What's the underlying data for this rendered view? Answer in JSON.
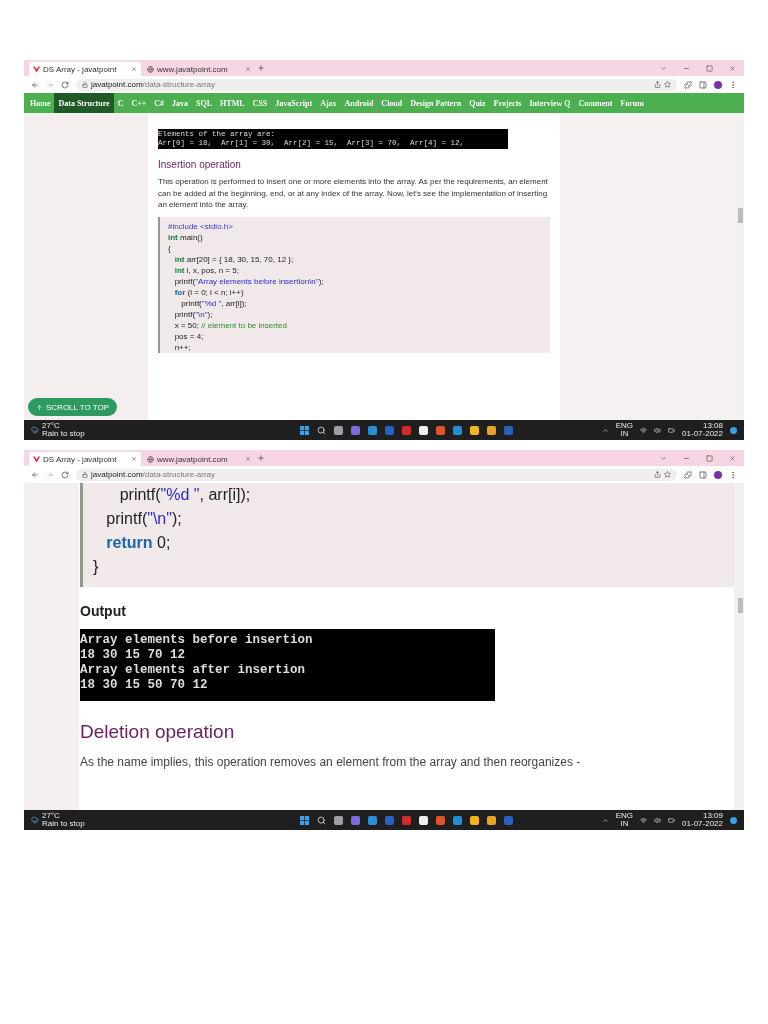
{
  "screenshots": [
    {
      "tabs": [
        {
          "title": "DS Array - javatpoint",
          "selected": true
        },
        {
          "title": "www.javatpoint.com",
          "selected": false
        }
      ],
      "address": {
        "domain": "javatpoint.com",
        "path": "/data-structure-array"
      },
      "nav": [
        {
          "label": "Home",
          "selected": false
        },
        {
          "label": "Data Structure",
          "selected": true
        },
        {
          "label": "C",
          "selected": false
        },
        {
          "label": "C++",
          "selected": false
        },
        {
          "label": "C#",
          "selected": false
        },
        {
          "label": "Java",
          "selected": false
        },
        {
          "label": "SQL",
          "selected": false
        },
        {
          "label": "HTML",
          "selected": false
        },
        {
          "label": "CSS",
          "selected": false
        },
        {
          "label": "JavaScript",
          "selected": false
        },
        {
          "label": "Ajax",
          "selected": false
        },
        {
          "label": "Android",
          "selected": false
        },
        {
          "label": "Cloud",
          "selected": false
        },
        {
          "label": "Design Pattern",
          "selected": false
        },
        {
          "label": "Quiz",
          "selected": false
        },
        {
          "label": "Projects",
          "selected": false
        },
        {
          "label": "Interview Q",
          "selected": false
        },
        {
          "label": "Comment",
          "selected": false
        },
        {
          "label": "Forum",
          "selected": false
        }
      ],
      "blocks": [
        {
          "kind": "console",
          "lines": [
            "Elements of the array are:",
            "Arr[0] = 18,  Arr[1] = 30,  Arr[2] = 15,  Arr[3] = 70,  Arr[4] = 12,"
          ]
        },
        {
          "kind": "heading",
          "text": "Insertion operation"
        },
        {
          "kind": "paragraph",
          "text": "This operation is performed to insert one or more elements into the array. As per the requirements, an element can be added at the beginning, end, or at any index of the array. Now, let's see the implementation of inserting an element into the array."
        },
        {
          "kind": "code",
          "lines": [
            [
              {
                "kind": "preproc",
                "text": "#include <stdio.h>"
              }
            ],
            [
              {
                "kind": "type",
                "text": "int"
              },
              {
                "kind": "plain",
                "text": " main()"
              }
            ],
            [
              {
                "kind": "plain",
                "text": "{"
              }
            ],
            [
              {
                "kind": "type",
                "text": "   int"
              },
              {
                "kind": "plain",
                "text": " arr[20] = { 18, 30, 15, 70, 12 };"
              }
            ],
            [
              {
                "kind": "type",
                "text": "   int"
              },
              {
                "kind": "plain",
                "text": " i, x, pos, n = 5;"
              }
            ],
            [
              {
                "kind": "plain",
                "text": "   printf("
              },
              {
                "kind": "string",
                "text": "\"Array elements before insertion\\n\""
              },
              {
                "kind": "plain",
                "text": ");"
              }
            ],
            [
              {
                "kind": "keyword",
                "text": "   for"
              },
              {
                "kind": "plain",
                "text": " (i = 0; i < n; i++)"
              }
            ],
            [
              {
                "kind": "plain",
                "text": "      printf("
              },
              {
                "kind": "string",
                "text": "\"%d \""
              },
              {
                "kind": "plain",
                "text": ", arr[i]);"
              }
            ],
            [
              {
                "kind": "plain",
                "text": "   printf("
              },
              {
                "kind": "string",
                "text": "\"\\n\""
              },
              {
                "kind": "plain",
                "text": ");"
              }
            ],
            [
              {
                "kind": "plain",
                "text": "   x = 50; "
              },
              {
                "kind": "comment",
                "text": "// element to be inserted"
              }
            ],
            [
              {
                "kind": "plain",
                "text": "   pos = 4;"
              }
            ],
            [
              {
                "kind": "plain",
                "text": "   n++;"
              }
            ]
          ]
        }
      ],
      "scroll_button": "SCROLL TO TOP",
      "taskbar": {
        "temperature": "27°C",
        "weather": "Rain to stop",
        "language": "ENG",
        "region": "IN",
        "time": "13:08",
        "date": "01-07-2022"
      }
    },
    {
      "tabs": [
        {
          "title": "DS Array - javatpoint",
          "selected": true
        },
        {
          "title": "www.javatpoint.com",
          "selected": false
        }
      ],
      "address": {
        "domain": "javatpoint.com",
        "path": "/data-structure-array"
      },
      "blocks": [
        {
          "kind": "code",
          "lines": [
            [
              {
                "kind": "plain",
                "text": "      printf("
              },
              {
                "kind": "string",
                "text": "\"%d \""
              },
              {
                "kind": "plain",
                "text": ", arr[i]);"
              }
            ],
            [
              {
                "kind": "plain",
                "text": "   printf("
              },
              {
                "kind": "string",
                "text": "\"\\n\""
              },
              {
                "kind": "plain",
                "text": ");"
              }
            ],
            [
              {
                "kind": "keyword",
                "text": "   return"
              },
              {
                "kind": "plain",
                "text": " 0;"
              }
            ],
            [
              {
                "kind": "plain",
                "text": "}"
              }
            ]
          ]
        },
        {
          "kind": "subheading",
          "text": "Output"
        },
        {
          "kind": "console",
          "lines": [
            "Array elements before insertion",
            "18 30 15 70 12",
            "Array elements after insertion",
            "18 30 15 50 70 12"
          ]
        },
        {
          "kind": "heading",
          "text": "Deletion operation"
        },
        {
          "kind": "paragraph",
          "text": "As the name implies, this operation removes an element from the array and then reorganizes -"
        }
      ],
      "taskbar": {
        "temperature": "27°C",
        "weather": "Rain to stop",
        "language": "ENG",
        "region": "IN",
        "time": "13:09",
        "date": "01-07-2022"
      }
    }
  ]
}
